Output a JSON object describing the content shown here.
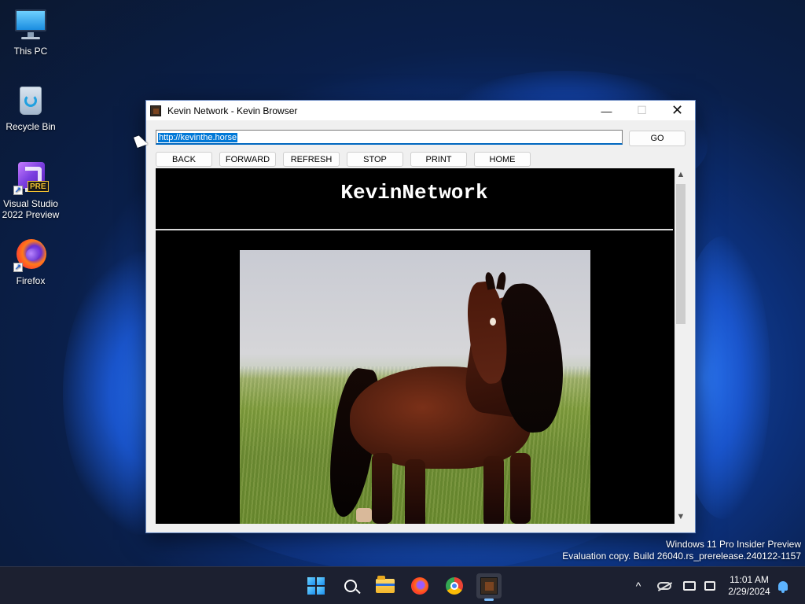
{
  "desktop": {
    "icons": [
      {
        "label": "This PC",
        "icon": "monitor-icon"
      },
      {
        "label": "Recycle Bin",
        "icon": "recycle-bin-icon"
      },
      {
        "label": "Visual Studio 2022 Preview",
        "icon": "visual-studio-icon",
        "badge": "PRE"
      },
      {
        "label": "Firefox",
        "icon": "firefox-icon"
      }
    ]
  },
  "window": {
    "title": "Kevin Network - Kevin Browser",
    "controls": {
      "minimize": "—",
      "maximize": "☐",
      "close": "✕"
    }
  },
  "browser": {
    "url": "http://kevinthe.horse",
    "go_label": "GO",
    "nav": {
      "back": "BACK",
      "forward": "FORWARD",
      "refresh": "REFRESH",
      "stop": "STOP",
      "print": "PRINT",
      "home": "HOME"
    },
    "page": {
      "heading": "KevinNetwork"
    },
    "scroll": {
      "up": "▲",
      "down": "▼"
    }
  },
  "watermark": {
    "line1": "Windows 11 Pro Insider Preview",
    "line2": "Evaluation copy. Build 26040.rs_prerelease.240122-1157"
  },
  "taskbar": {
    "apps": [
      "start-icon",
      "search-icon",
      "file-explorer-icon",
      "firefox-icon",
      "chrome-icon",
      "kevin-browser-icon"
    ],
    "tray": {
      "chevron": "^"
    },
    "clock": {
      "time": "11:01 AM",
      "date": "2/29/2024"
    }
  }
}
